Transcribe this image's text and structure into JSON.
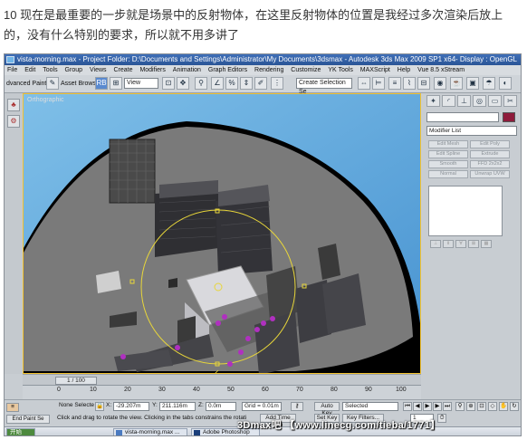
{
  "caption": "10 现在是最重要的一步就是场景中的反射物体，在这里反射物体的位置是我经过多次渲染后放上的，没有什么特别的要求，所以就不用多讲了",
  "window": {
    "title": "vista-morning.max - Project Folder: D:\\Documents and Settings\\Administrator\\My Documents\\3dsmax - Autodesk 3ds Max 2009 SP1 x64",
    "right_text": "- Display : OpenGL",
    "app_icon": "3dsmax-app-icon"
  },
  "menu": [
    "File",
    "Edit",
    "Tools",
    "Group",
    "Views",
    "Create",
    "Modifiers",
    "Animation",
    "Graph Editors",
    "Rendering",
    "Customize",
    "YK Tools",
    "MAXScript",
    "Help",
    "Vue 8.5 xStream"
  ],
  "toolbar": {
    "advanced_paint": "dvanced Paint",
    "asset_browser": "Asset Browser",
    "rb_label": "RB",
    "view_combo": "View",
    "selection_set_placeholder": "Create Selection Se"
  },
  "viewport": {
    "label": "Orthographic",
    "frame_indicator": "1 / 100"
  },
  "command_panel": {
    "modifier_list": "Modifier List",
    "swatch_color": "#8e1b3b",
    "buttons": [
      "Edit Mesh",
      "Edit Poly",
      "Edit Spline",
      "Extrude",
      "Smooth",
      "FFD 2x2x2",
      "Normal",
      "Unwrap UVW"
    ]
  },
  "timeline": {
    "ticks": [
      "0",
      "10",
      "20",
      "30",
      "40",
      "50",
      "60",
      "70",
      "80",
      "90",
      "100"
    ]
  },
  "status": {
    "selection": "None Selecte",
    "x_label": "X:",
    "x_value": "-29.207m",
    "y_label": "Y:",
    "y_value": "211.116m",
    "z_label": "Z:",
    "z_value": "0.0m",
    "grid": "Grid = 0.01m",
    "add_time_tag": "Add Time Tag",
    "auto_key": "Auto Key",
    "selected": "Selected",
    "set_key": "Set Key",
    "key_filters": "Key Filters...",
    "frame_value": "1",
    "end_paint": "End Paint Se",
    "prompt": "Click and drag to rotate the view. Clicking in the tabs constrains the rotati"
  },
  "taskbar": {
    "start": "开始",
    "items": [
      "vista-morning.max ...",
      "Adobe Photoshop"
    ]
  },
  "watermark": "3Dmax吧 【www.linecg.com/tieba/1771】"
}
